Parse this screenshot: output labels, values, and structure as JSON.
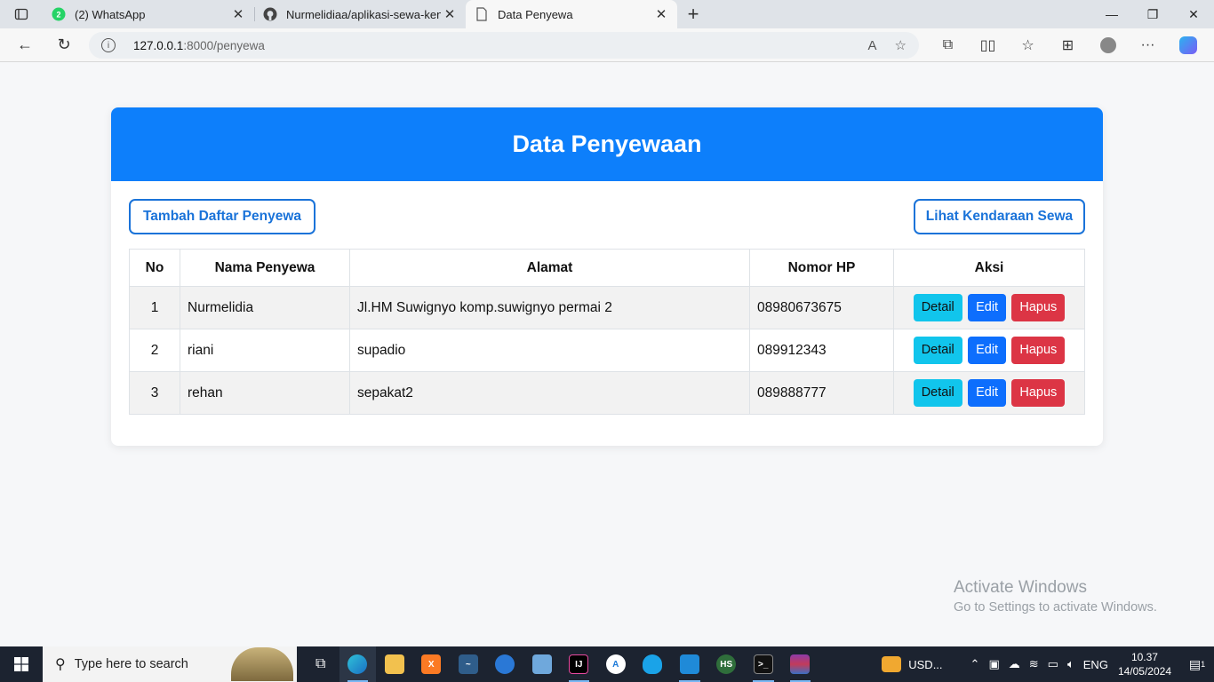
{
  "browser": {
    "tabs": [
      {
        "title": "(2) WhatsApp",
        "badge": "2",
        "icon": "whatsapp-icon",
        "active": false
      },
      {
        "title": "Nurmelidiaa/aplikasi-sewa-kend",
        "icon": "github-icon",
        "active": false
      },
      {
        "title": "Data Penyewa",
        "icon": "page-icon",
        "active": true
      }
    ],
    "url_host": "127.0.0.1",
    "url_path": ":8000/penyewa"
  },
  "page": {
    "heading": "Data Penyewaan",
    "add_button": "Tambah Daftar Penyewa",
    "view_button": "Lihat Kendaraan Sewa",
    "columns": [
      "No",
      "Nama Penyewa",
      "Alamat",
      "Nomor HP",
      "Aksi"
    ],
    "rows": [
      {
        "no": "1",
        "nama": "Nurmelidia",
        "alamat": "Jl.HM Suwignyo komp.suwignyo permai 2",
        "hp": "08980673675"
      },
      {
        "no": "2",
        "nama": "riani",
        "alamat": "supadio",
        "hp": "089912343"
      },
      {
        "no": "3",
        "nama": "rehan",
        "alamat": "sepakat2",
        "hp": "089888777"
      }
    ],
    "actions": {
      "detail": "Detail",
      "edit": "Edit",
      "hapus": "Hapus"
    },
    "colors": {
      "header": "#0d7ffb",
      "detail": "#11c5ec",
      "edit": "#0d6efd",
      "hapus": "#dc3545"
    }
  },
  "watermark": {
    "line1": "Activate Windows",
    "line2": "Go to Settings to activate Windows."
  },
  "taskbar": {
    "search_placeholder": "Type here to search",
    "weather": "USD...",
    "language": "ENG",
    "time": "10.37",
    "date": "14/05/2024",
    "notification_count": "1"
  }
}
